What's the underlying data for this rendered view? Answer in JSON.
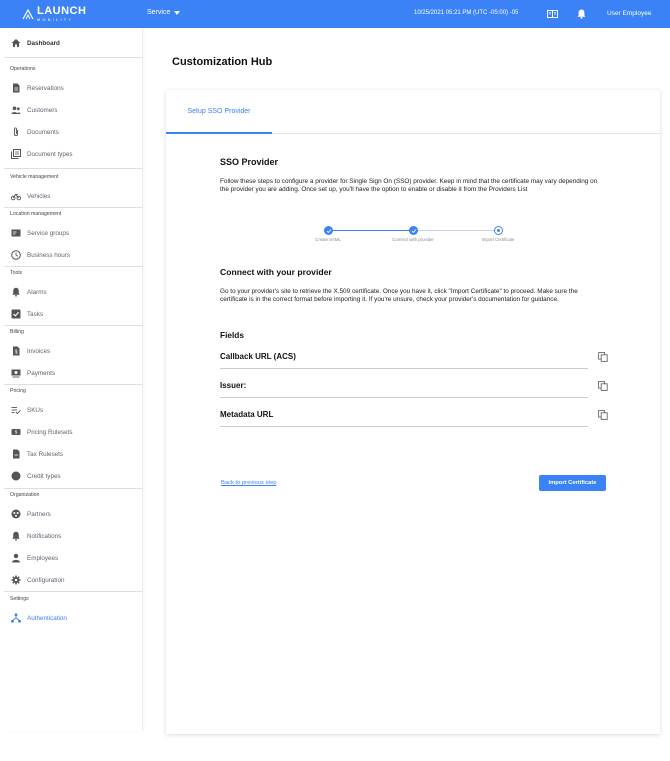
{
  "header": {
    "logo_main": "LAUNCH",
    "logo_sub": "MOBILITY",
    "service_label": "Service",
    "datetime": "10/25/2021 05:21 PM (UTC -05:00) -05",
    "user": "User Employee",
    "bg_color": "#3b82f6"
  },
  "sidebar": {
    "dashboard": "Dashboard",
    "sections": {
      "operations": "Operations",
      "vehicle_management": "Vehicle management",
      "location_management": "Location management",
      "tools": "Tools",
      "billing": "Billing",
      "pricing": "Pricing",
      "organization": "Organization",
      "settings": "Settings"
    },
    "items": {
      "reservations": "Reservations",
      "customers": "Customers",
      "documents": "Documents",
      "document_types": "Document types",
      "vehicles": "Vehicles",
      "service_groups": "Service groups",
      "business_hours": "Business hours",
      "alarms": "Alarms",
      "tasks": "Tasks",
      "invoices": "Invoices",
      "payments": "Payments",
      "skus": "SKUs",
      "pricing_rulesets": "Pricing Rulesets",
      "tax_rulesets": "Tax Rulesets",
      "credit_types": "Credit types",
      "partners": "Partners",
      "notifications": "Notifications",
      "employees": "Employees",
      "configuration": "Configuration",
      "authentication": "Authentication"
    },
    "icons": {
      "dashboard": "home-icon",
      "reservations": "document-icon",
      "customers": "people-icon",
      "documents": "paperclip-icon",
      "document_types": "stack-icon",
      "vehicles": "bike-icon",
      "service_groups": "group-card-icon",
      "business_hours": "clock-icon",
      "alarms": "bell-icon",
      "tasks": "checkbox-icon",
      "invoices": "invoice-icon",
      "payments": "payment-icon",
      "skus": "list-check-icon",
      "pricing_rulesets": "tag-icon",
      "tax_rulesets": "file-icon",
      "credit_types": "circle-icon",
      "partners": "handshake-icon",
      "notifications": "bell-icon",
      "employees": "person-icon",
      "configuration": "gear-icon",
      "authentication": "network-icon"
    },
    "active_item": "authentication",
    "active_color": "#3b82f6"
  },
  "main": {
    "title": "Customization Hub",
    "tab_label": "Setup SSO Provider",
    "sso_title": "SSO Provider",
    "sso_description": "Follow these steps to configure a provider for Single Sign On (SSO) provider. Keep in mind that the certificate may vary depending on the provider you are adding. Once set up, you'll have the option to enable or disable it from the Providers List",
    "steps": [
      {
        "label": "Create SAML",
        "status": "done"
      },
      {
        "label": "Connect with provider",
        "status": "done"
      },
      {
        "label": "Import Certificate",
        "status": "current"
      }
    ],
    "connect_title": "Connect with your provider",
    "connect_description": "Go to your provider's site to retrieve the X.509 certificate. Once you have it, click \"Import Certificate\" to proceed. Make sure the certificate is in the correct format before importing it. If you're unsure, check your provider's documentation for guidance.",
    "fields_title": "Fields",
    "fields": [
      {
        "label": "Callback URL (ACS)"
      },
      {
        "label": "Issuer:"
      },
      {
        "label": "Metadata URL"
      }
    ],
    "back_link": "Back to previous step",
    "import_button": "Import Certificate"
  }
}
